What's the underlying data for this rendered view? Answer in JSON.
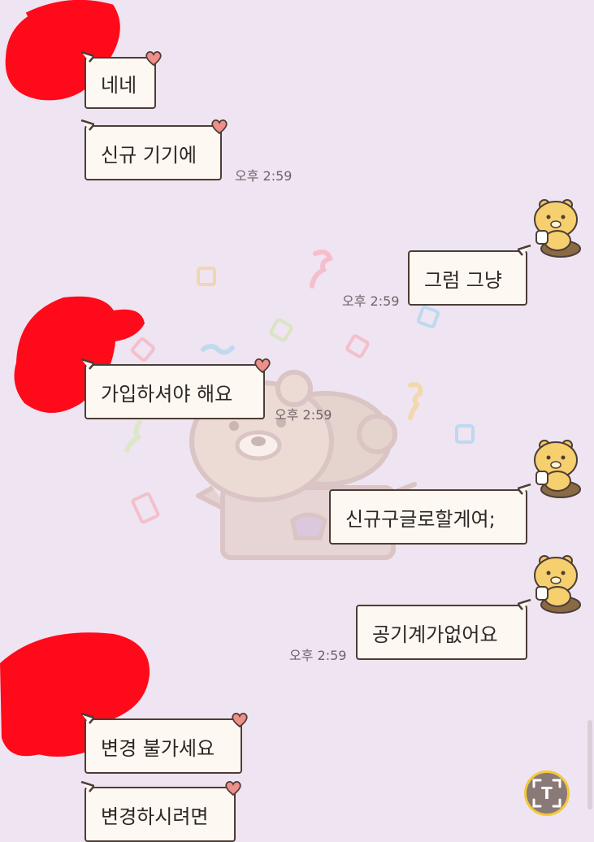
{
  "messages": [
    {
      "side": "left",
      "text": "네네",
      "time": ""
    },
    {
      "side": "left",
      "text": "신규 기기에",
      "time": "오후 2:59"
    },
    {
      "side": "right",
      "text": "그럼 그냥",
      "time": "오후 2:59"
    },
    {
      "side": "left",
      "text": "가입하셔야 해요",
      "time": "오후 2:59"
    },
    {
      "side": "right",
      "text": "신규구글로할게여;",
      "time": ""
    },
    {
      "side": "right",
      "text": "공기계가없어요",
      "time": "오후 2:59"
    },
    {
      "side": "left",
      "text": "변경 불가세요",
      "time": ""
    },
    {
      "side": "left",
      "text": "변경하시려면",
      "time": ""
    }
  ],
  "fab": {
    "glyph": "T",
    "icon": "text-scan-icon"
  },
  "colors": {
    "background": "#efe4f1",
    "bubble": "#fdf8f1",
    "bubble_border": "#4d3d37",
    "heart": "#ee8f8a",
    "redaction": "#ff0a1a",
    "fab_border": "#f3c93a"
  }
}
